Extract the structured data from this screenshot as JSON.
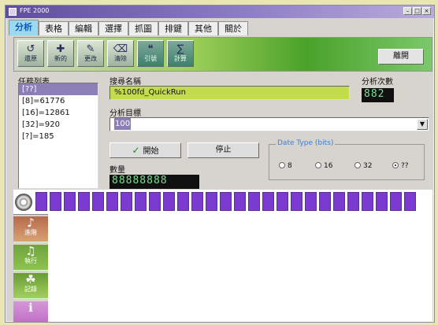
{
  "window": {
    "title": "FPE 2000"
  },
  "tabs": [
    "分析",
    "表格",
    "編輯",
    "選擇",
    "抓圖",
    "排鍵",
    "其他",
    "關於"
  ],
  "toolbar": {
    "buttons": [
      {
        "label": "還原",
        "icon": "restore-icon"
      },
      {
        "label": "新的",
        "icon": "new-icon"
      },
      {
        "label": "更改",
        "icon": "change-icon"
      },
      {
        "label": "清除",
        "icon": "clear-icon"
      },
      {
        "label": "引號",
        "icon": "quote-icon"
      },
      {
        "label": "計算",
        "icon": "calculate-icon"
      }
    ],
    "exit_label": "離開"
  },
  "task_list": {
    "label": "任務列表",
    "items": [
      "[??]",
      "[8]=61776",
      "[16]=12861",
      "[32]=920",
      "[?]=185"
    ]
  },
  "search_label": "搜尋名稱",
  "search_value": "%100fd_QuickRun",
  "count_label": "分析次數",
  "count_value": "882",
  "target_label": "分析目標",
  "target_value": "100",
  "start_label": "開始",
  "stop_label": "停止",
  "quantity_label": "數量",
  "quantity_value": "88888888",
  "data_type": {
    "title": "Date Type (bits)",
    "options": [
      {
        "label": "8",
        "checked": false
      },
      {
        "label": "16",
        "checked": false
      },
      {
        "label": "32",
        "checked": false
      },
      {
        "label": "??",
        "checked": true
      }
    ]
  },
  "sidebar": [
    {
      "label": "進階",
      "icon": "advanced-icon"
    },
    {
      "label": "執行",
      "icon": "run-icon"
    },
    {
      "label": "記錄",
      "icon": "log-icon"
    },
    {
      "label": "",
      "icon": "info-icon"
    }
  ]
}
